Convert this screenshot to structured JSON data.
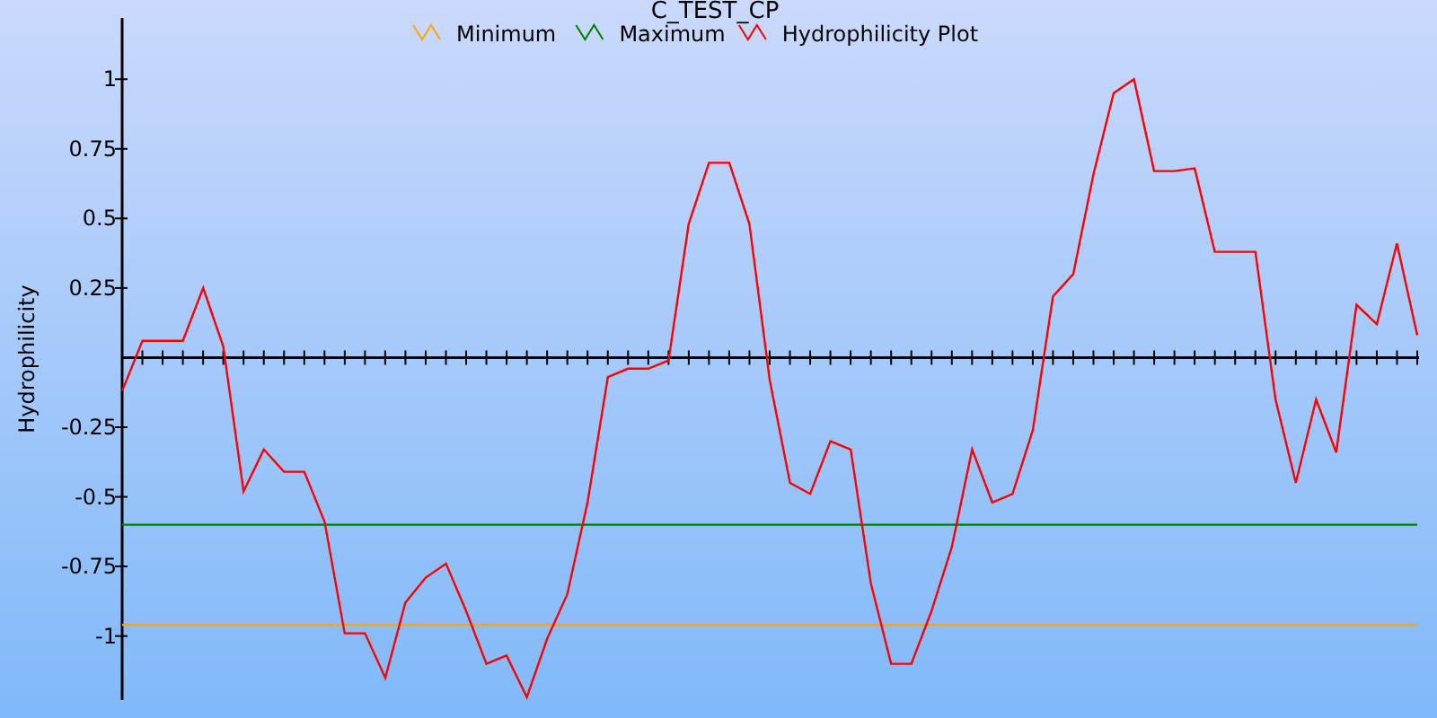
{
  "chart_data": {
    "type": "line",
    "title": "C_TEST_CP",
    "ylabel": "Hydrophilicity",
    "categories": [
      null,
      null,
      null,
      null,
      null,
      null,
      null,
      null,
      null,
      null,
      null,
      null,
      null,
      null,
      null,
      null,
      null,
      null,
      null,
      null,
      null,
      null,
      null,
      null,
      null,
      null,
      null,
      null,
      null,
      null,
      null,
      null,
      null,
      null,
      null,
      null,
      null,
      null,
      null,
      null,
      null,
      null,
      null,
      null,
      null,
      null,
      null,
      null,
      null,
      null,
      null,
      null,
      null,
      null,
      null,
      null,
      null,
      null,
      null,
      null,
      null,
      null,
      null,
      null,
      null
    ],
    "ylim": [
      -1.23,
      1.22
    ],
    "legend": "top",
    "yticks": [
      -1,
      -0.75,
      -0.5,
      -0.25,
      0.25,
      0.5,
      0.75,
      1
    ],
    "series": [
      {
        "name": "Minimum",
        "color": "#ffa500",
        "values": [
          -0.96,
          -0.96,
          -0.96,
          -0.96,
          -0.96,
          -0.96,
          -0.96,
          -0.96,
          -0.96,
          -0.96,
          -0.96,
          -0.96,
          -0.96,
          -0.96,
          -0.96,
          -0.96,
          -0.96,
          -0.96,
          -0.96,
          -0.96,
          -0.96,
          -0.96,
          -0.96,
          -0.96,
          -0.96,
          -0.96,
          -0.96,
          -0.96,
          -0.96,
          -0.96,
          -0.96,
          -0.96,
          -0.96,
          -0.96,
          -0.96,
          -0.96,
          -0.96,
          -0.96,
          -0.96,
          -0.96,
          -0.96,
          -0.96,
          -0.96,
          -0.96,
          -0.96,
          -0.96,
          -0.96,
          -0.96,
          -0.96,
          -0.96,
          -0.96,
          -0.96,
          -0.96,
          -0.96,
          -0.96,
          -0.96,
          -0.96,
          -0.96,
          -0.96,
          -0.96,
          -0.96,
          -0.96,
          -0.96,
          -0.96,
          -0.96
        ]
      },
      {
        "name": "Maximum",
        "color": "#008000",
        "values": [
          -0.6,
          -0.6,
          -0.6,
          -0.6,
          -0.6,
          -0.6,
          -0.6,
          -0.6,
          -0.6,
          -0.6,
          -0.6,
          -0.6,
          -0.6,
          -0.6,
          -0.6,
          -0.6,
          -0.6,
          -0.6,
          -0.6,
          -0.6,
          -0.6,
          -0.6,
          -0.6,
          -0.6,
          -0.6,
          -0.6,
          -0.6,
          -0.6,
          -0.6,
          -0.6,
          -0.6,
          -0.6,
          -0.6,
          -0.6,
          -0.6,
          -0.6,
          -0.6,
          -0.6,
          -0.6,
          -0.6,
          -0.6,
          -0.6,
          -0.6,
          -0.6,
          -0.6,
          -0.6,
          -0.6,
          -0.6,
          -0.6,
          -0.6,
          -0.6,
          -0.6,
          -0.6,
          -0.6,
          -0.6,
          -0.6,
          -0.6,
          -0.6,
          -0.6,
          -0.6,
          -0.6,
          -0.6,
          -0.6,
          -0.6,
          -0.6
        ]
      },
      {
        "name": "Hydrophilicity Plot",
        "color": "#ff0000",
        "values": [
          -0.12,
          0.06,
          0.06,
          0.06,
          0.25,
          0.04,
          -0.48,
          -0.33,
          -0.41,
          -0.41,
          -0.59,
          -0.99,
          -0.99,
          -1.15,
          -0.88,
          -0.79,
          -0.74,
          -0.91,
          -1.1,
          -1.07,
          -1.22,
          -1.01,
          -0.85,
          -0.52,
          -0.07,
          -0.04,
          -0.04,
          -0.01,
          0.48,
          0.7,
          0.7,
          0.48,
          -0.08,
          -0.45,
          -0.49,
          -0.3,
          -0.33,
          -0.81,
          -1.1,
          -1.1,
          -0.91,
          -0.68,
          -0.33,
          -0.52,
          -0.49,
          -0.26,
          0.22,
          0.3,
          0.66,
          0.95,
          1.0,
          0.67,
          0.67,
          0.68,
          0.38,
          0.38,
          0.38,
          -0.15,
          -0.45,
          -0.15,
          -0.34,
          0.19,
          0.12,
          0.41,
          0.08
        ]
      }
    ]
  }
}
